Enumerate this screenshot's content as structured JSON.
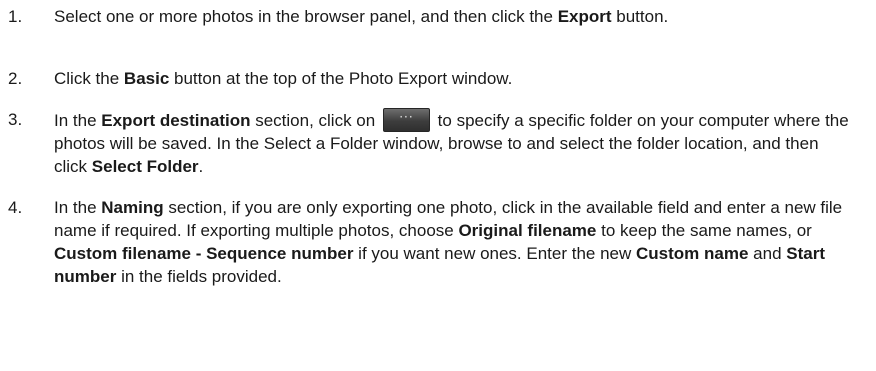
{
  "steps": [
    {
      "number": "1.",
      "parts": [
        "Select one or more photos in the browser panel, and then click the ",
        "Export",
        " button."
      ]
    },
    {
      "number": "2.",
      "parts": [
        "Click the ",
        "Basic",
        " button at the top of the Photo Export window."
      ]
    },
    {
      "number": "3.",
      "parts": [
        "In the ",
        "Export destination",
        " section, click on ",
        " to specify a specific folder on your computer where the photos will be saved. In the Select a Folder window, browse to and select the folder location, and then click ",
        "Select Folder",
        "."
      ],
      "icon": {
        "name": "ellipsis-button-icon",
        "glyph": "···"
      }
    },
    {
      "number": "4.",
      "parts": [
        "In the ",
        "Naming",
        " section, if you are only exporting one photo, click in the available field and enter a new file name if required. If exporting multiple photos, choose ",
        "Original filename",
        " to keep the same names, or ",
        "Custom filename - Sequence number",
        " if you want new ones. Enter the new ",
        "Custom name",
        " and ",
        "Start number",
        " in the fields provided."
      ]
    }
  ]
}
